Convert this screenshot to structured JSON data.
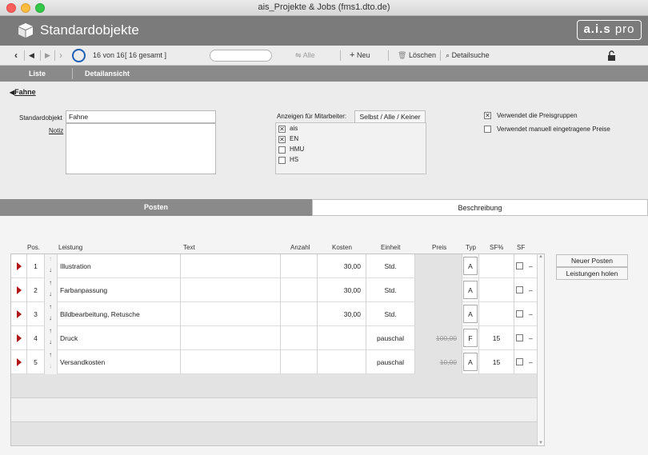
{
  "window": {
    "title": "ais_Projekte & Jobs (fms1.dto.de)"
  },
  "header": {
    "title": "Standardobjekte",
    "logo_main": "a.i.s",
    "logo_sub": "pro"
  },
  "toolbar": {
    "record_info": "16 von 16",
    "record_total": "[ 16 gesamt ]",
    "search_placeholder": "",
    "alle_label": "Alle",
    "neu_label": "Neu",
    "loeschen_label": "Löschen",
    "detailsuche_label": "Detailsuche"
  },
  "nav": {
    "tabs": [
      "Liste",
      "Detailansicht"
    ]
  },
  "breadcrumb": {
    "label": "Fahne"
  },
  "form": {
    "standardobjekt_label": "Standardobjekt",
    "standardobjekt_value": "Fahne",
    "notiz_label": "Notiz",
    "notiz_value": "",
    "anzeigen_label": "Anzeigen für Mitarbeiter:",
    "selbst_button": "Selbst / Alle / Keiner",
    "mitarbeiter": [
      {
        "name": "ais",
        "checked": true
      },
      {
        "name": "EN",
        "checked": true
      },
      {
        "name": "HMU",
        "checked": false
      },
      {
        "name": "HS",
        "checked": false
      }
    ],
    "options": [
      {
        "label": "Verwendet die Preisgruppen",
        "checked": true
      },
      {
        "label": "Verwendet manuell eingetragene Preise",
        "checked": false
      }
    ]
  },
  "section_tabs": [
    "Posten",
    "Beschreibung"
  ],
  "table": {
    "headers": [
      "Pos.",
      "Leistung",
      "Text",
      "Anzahl",
      "Kosten",
      "Einheit",
      "Preis",
      "Typ",
      "SF%",
      "SF"
    ],
    "rows": [
      {
        "pos": "1",
        "leistung": "Illustration",
        "text": "",
        "anzahl": "",
        "kosten": "30,00",
        "einheit": "Std.",
        "preis": "",
        "typ": "A",
        "sf_pct": "",
        "sf_dash": "–"
      },
      {
        "pos": "2",
        "leistung": "Farbanpassung",
        "text": "",
        "anzahl": "",
        "kosten": "30,00",
        "einheit": "Std.",
        "preis": "",
        "typ": "A",
        "sf_pct": "",
        "sf_dash": "–"
      },
      {
        "pos": "3",
        "leistung": "Bildbearbeitung, Retusche",
        "text": "",
        "anzahl": "",
        "kosten": "30,00",
        "einheit": "Std.",
        "preis": "",
        "typ": "A",
        "sf_pct": "",
        "sf_dash": "–"
      },
      {
        "pos": "4",
        "leistung": "Druck",
        "text": "",
        "anzahl": "",
        "kosten": "",
        "einheit": "pauschal",
        "preis": "100,00",
        "typ": "F",
        "sf_pct": "15",
        "sf_dash": "–"
      },
      {
        "pos": "5",
        "leistung": "Versandkosten",
        "text": "",
        "anzahl": "",
        "kosten": "",
        "einheit": "pauschal",
        "preis": "10,00",
        "typ": "A",
        "sf_pct": "15",
        "sf_dash": "–"
      }
    ]
  },
  "side_buttons": {
    "neuer_posten": "Neuer Posten",
    "leistungen_holen": "Leistungen holen"
  },
  "colors": {
    "header_bg": "#7b7b7b",
    "nav_bg": "#8a8a8a",
    "accent_red": "#b01818",
    "toolbar_circle": "#1f5fb5"
  }
}
